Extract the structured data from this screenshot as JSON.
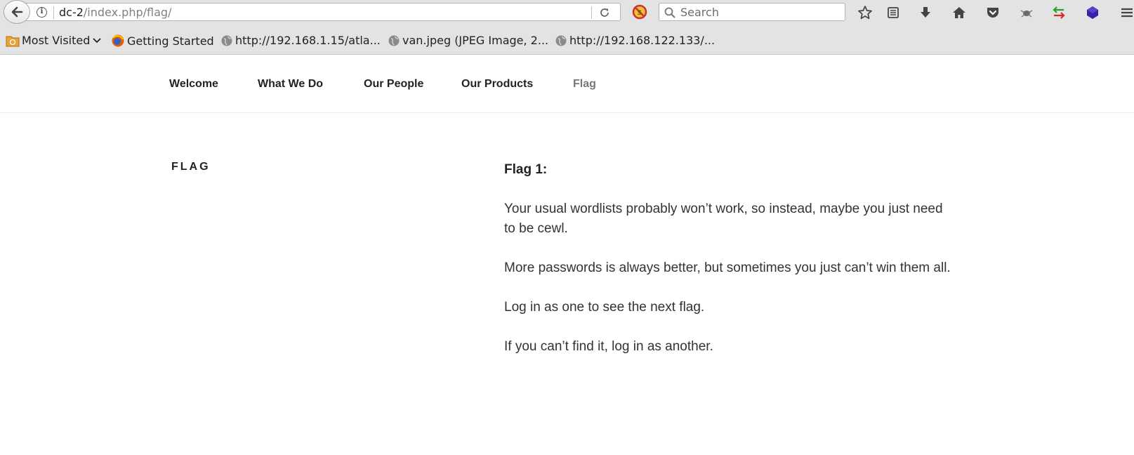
{
  "browser": {
    "url_host": "dc-2",
    "url_path": "/index.php/flag/",
    "search_placeholder": "Search",
    "bookmarks": [
      {
        "label": "Most Visited",
        "icon": "folder-icon"
      },
      {
        "label": "Getting Started",
        "icon": "firefox-icon"
      },
      {
        "label": "http://192.168.1.15/atla...",
        "icon": "globe-icon"
      },
      {
        "label": "van.jpeg (JPEG Image, 2...",
        "icon": "globe-icon"
      },
      {
        "label": "http://192.168.122.133/...",
        "icon": "globe-icon"
      }
    ]
  },
  "site": {
    "nav": [
      {
        "label": "Welcome"
      },
      {
        "label": "What We Do"
      },
      {
        "label": "Our People"
      },
      {
        "label": "Our Products"
      },
      {
        "label": "Flag"
      }
    ],
    "current_nav": "Flag",
    "page_title": "FLAG",
    "content": {
      "heading": "Flag 1:",
      "paragraphs": [
        "Your usual wordlists probably won’t work, so instead, maybe you just need to be cewl.",
        "More passwords is always better, but sometimes you just can’t win them all.",
        "Log in as one to see the next flag.",
        "If you can’t find it, log in as another."
      ]
    }
  }
}
